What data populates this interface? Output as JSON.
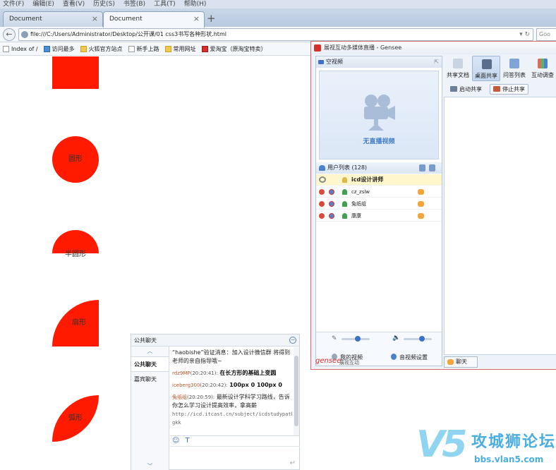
{
  "browser": {
    "menu": [
      "文件(F)",
      "编辑(E)",
      "查看(V)",
      "历史(S)",
      "书签(B)",
      "工具(T)",
      "帮助(H)"
    ],
    "tabs": [
      {
        "label": "Document",
        "active": false
      },
      {
        "label": "Document",
        "active": true
      }
    ],
    "new_tab": "+",
    "url": "file:///C:/Users/Administrator/Desktop/公开课/01 css3书写各种形状.html",
    "search_placeholder": "Goo",
    "bookmarks": [
      "Index of /",
      "访问最多",
      "火狐官方站点",
      "新手上路",
      "常用网址",
      "爱淘宝（原淘宝特卖）"
    ]
  },
  "page": {
    "shapes": [
      {
        "name": "square",
        "label": ""
      },
      {
        "name": "circle",
        "label": "圆形"
      },
      {
        "name": "semicircle",
        "label": "半圆形"
      },
      {
        "name": "fan",
        "label": "扇形"
      },
      {
        "name": "arc",
        "label": "弧形"
      }
    ],
    "shape_color": "#ff1a00"
  },
  "gensee": {
    "title": "展视互动多媒体直播 - Gensee",
    "video": {
      "header": "空视频",
      "placeholder": "无直播视频"
    },
    "users": {
      "header": "用户列表 (128)",
      "list": [
        {
          "name": "icd设计讲师",
          "host": true
        },
        {
          "name": "cz_zslw",
          "host": false
        },
        {
          "name": "兔纸组",
          "host": false
        },
        {
          "name": "康康",
          "host": false
        }
      ]
    },
    "controls": {
      "my_video": "我的视频",
      "av_settings": "音视频设置",
      "mic_level": 0.6,
      "speaker_level": 0.7
    },
    "toolbar": [
      "共享文档",
      "桌面共享",
      "问答列表",
      "互动调查"
    ],
    "sub": {
      "start_share": "启动共享",
      "stop_share": "停止共享"
    },
    "chat_tab": "聊天",
    "brand": "gensee",
    "brand_sub": "展视互动"
  },
  "chat": {
    "title": "公共聊天",
    "tabs": [
      "公共聊天",
      "嘉宾聊天"
    ],
    "messages": {
      "m1": "“haobishe”验证消息：加入设计微信群   将得到老师的亲自指导哦~",
      "m2_name": "rdz9MP",
      "m2_time": "(20:20:41):",
      "m2_text": "在长方形的基础上变圆",
      "m3_name": "iceberg300",
      "m3_time": "(20:20:42):",
      "m3_text": "100px 0 100px 0",
      "m4_name": "兔纸组",
      "m4_time": "(20:20:59):",
      "m4_text": "最新设计学科学习路线，告诉你怎么学习设计提高效率，拿高薪",
      "m4_url": "http://icd.itcast.cn/subject/icdstudypath/index.shtml?gkk"
    }
  },
  "watermark": {
    "logo": "V5",
    "text": "攻城狮论坛",
    "url": "bbs.vlan5.com"
  }
}
